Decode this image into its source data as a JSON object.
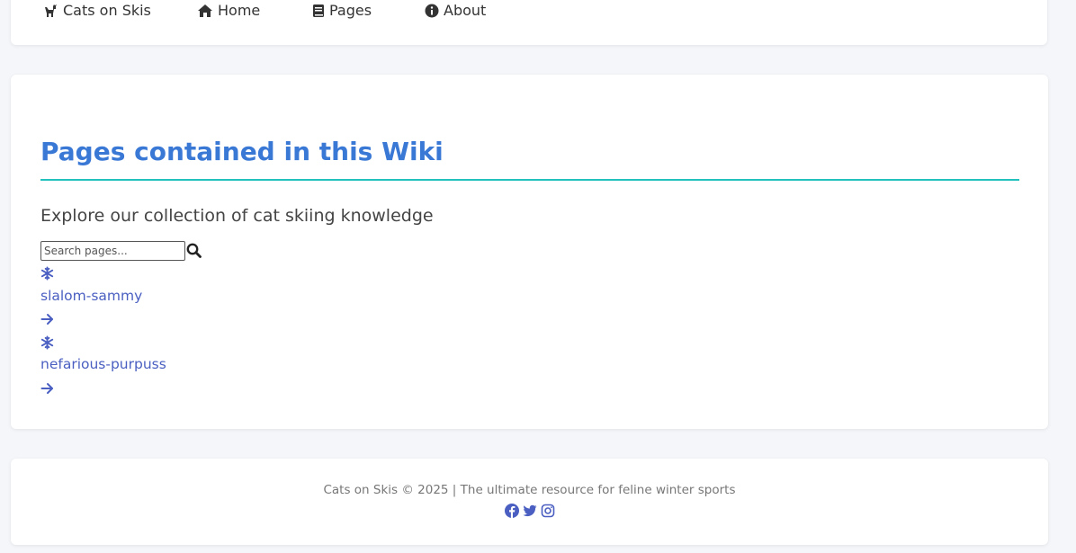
{
  "nav": {
    "brand": "Cats on Skis",
    "items": [
      {
        "label": "Home",
        "icon": "home-icon"
      },
      {
        "label": "Pages",
        "icon": "book-icon"
      },
      {
        "label": "About",
        "icon": "info-icon"
      }
    ]
  },
  "main": {
    "title": "Pages contained in this Wiki",
    "subtitle": "Explore our collection of cat skiing knowledge",
    "search": {
      "placeholder": "Search pages..."
    },
    "pages": [
      {
        "name": "slalom-sammy",
        "icon": "snowflake-icon",
        "action_icon": "arrow-right-icon"
      },
      {
        "name": "nefarious-purpuss",
        "icon": "snowflake-icon",
        "action_icon": "arrow-right-icon"
      }
    ]
  },
  "footer": {
    "text": "Cats on Skis © 2025 | The ultimate resource for feline winter sports",
    "social": [
      "facebook-icon",
      "twitter-icon",
      "instagram-icon"
    ]
  },
  "colors": {
    "title": "#3a78d6",
    "accent_rule": "#22c1bd",
    "link": "#4a5fc1",
    "background": "#f4f6fa"
  }
}
